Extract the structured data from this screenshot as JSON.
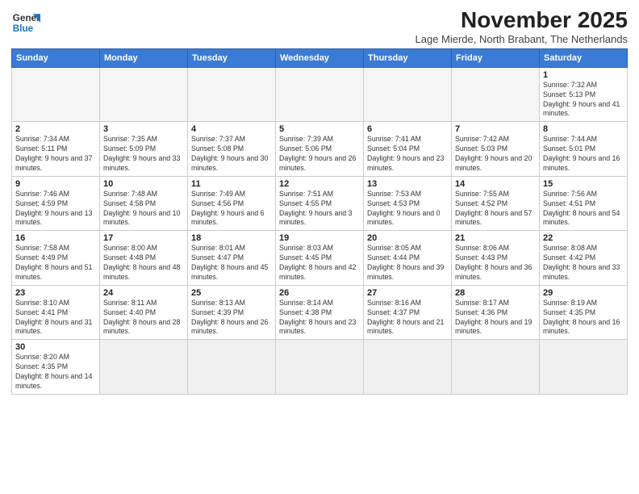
{
  "logo": {
    "line1": "General",
    "line2": "Blue"
  },
  "title": "November 2025",
  "subtitle": "Lage Mierde, North Brabant, The Netherlands",
  "headers": [
    "Sunday",
    "Monday",
    "Tuesday",
    "Wednesday",
    "Thursday",
    "Friday",
    "Saturday"
  ],
  "weeks": [
    [
      {
        "day": "",
        "info": ""
      },
      {
        "day": "",
        "info": ""
      },
      {
        "day": "",
        "info": ""
      },
      {
        "day": "",
        "info": ""
      },
      {
        "day": "",
        "info": ""
      },
      {
        "day": "",
        "info": ""
      },
      {
        "day": "1",
        "info": "Sunrise: 7:32 AM\nSunset: 5:13 PM\nDaylight: 9 hours and 41 minutes."
      }
    ],
    [
      {
        "day": "2",
        "info": "Sunrise: 7:34 AM\nSunset: 5:11 PM\nDaylight: 9 hours and 37 minutes."
      },
      {
        "day": "3",
        "info": "Sunrise: 7:35 AM\nSunset: 5:09 PM\nDaylight: 9 hours and 33 minutes."
      },
      {
        "day": "4",
        "info": "Sunrise: 7:37 AM\nSunset: 5:08 PM\nDaylight: 9 hours and 30 minutes."
      },
      {
        "day": "5",
        "info": "Sunrise: 7:39 AM\nSunset: 5:06 PM\nDaylight: 9 hours and 26 minutes."
      },
      {
        "day": "6",
        "info": "Sunrise: 7:41 AM\nSunset: 5:04 PM\nDaylight: 9 hours and 23 minutes."
      },
      {
        "day": "7",
        "info": "Sunrise: 7:42 AM\nSunset: 5:03 PM\nDaylight: 9 hours and 20 minutes."
      },
      {
        "day": "8",
        "info": "Sunrise: 7:44 AM\nSunset: 5:01 PM\nDaylight: 9 hours and 16 minutes."
      }
    ],
    [
      {
        "day": "9",
        "info": "Sunrise: 7:46 AM\nSunset: 4:59 PM\nDaylight: 9 hours and 13 minutes."
      },
      {
        "day": "10",
        "info": "Sunrise: 7:48 AM\nSunset: 4:58 PM\nDaylight: 9 hours and 10 minutes."
      },
      {
        "day": "11",
        "info": "Sunrise: 7:49 AM\nSunset: 4:56 PM\nDaylight: 9 hours and 6 minutes."
      },
      {
        "day": "12",
        "info": "Sunrise: 7:51 AM\nSunset: 4:55 PM\nDaylight: 9 hours and 3 minutes."
      },
      {
        "day": "13",
        "info": "Sunrise: 7:53 AM\nSunset: 4:53 PM\nDaylight: 9 hours and 0 minutes."
      },
      {
        "day": "14",
        "info": "Sunrise: 7:55 AM\nSunset: 4:52 PM\nDaylight: 8 hours and 57 minutes."
      },
      {
        "day": "15",
        "info": "Sunrise: 7:56 AM\nSunset: 4:51 PM\nDaylight: 8 hours and 54 minutes."
      }
    ],
    [
      {
        "day": "16",
        "info": "Sunrise: 7:58 AM\nSunset: 4:49 PM\nDaylight: 8 hours and 51 minutes."
      },
      {
        "day": "17",
        "info": "Sunrise: 8:00 AM\nSunset: 4:48 PM\nDaylight: 8 hours and 48 minutes."
      },
      {
        "day": "18",
        "info": "Sunrise: 8:01 AM\nSunset: 4:47 PM\nDaylight: 8 hours and 45 minutes."
      },
      {
        "day": "19",
        "info": "Sunrise: 8:03 AM\nSunset: 4:45 PM\nDaylight: 8 hours and 42 minutes."
      },
      {
        "day": "20",
        "info": "Sunrise: 8:05 AM\nSunset: 4:44 PM\nDaylight: 8 hours and 39 minutes."
      },
      {
        "day": "21",
        "info": "Sunrise: 8:06 AM\nSunset: 4:43 PM\nDaylight: 8 hours and 36 minutes."
      },
      {
        "day": "22",
        "info": "Sunrise: 8:08 AM\nSunset: 4:42 PM\nDaylight: 8 hours and 33 minutes."
      }
    ],
    [
      {
        "day": "23",
        "info": "Sunrise: 8:10 AM\nSunset: 4:41 PM\nDaylight: 8 hours and 31 minutes."
      },
      {
        "day": "24",
        "info": "Sunrise: 8:11 AM\nSunset: 4:40 PM\nDaylight: 8 hours and 28 minutes."
      },
      {
        "day": "25",
        "info": "Sunrise: 8:13 AM\nSunset: 4:39 PM\nDaylight: 8 hours and 26 minutes."
      },
      {
        "day": "26",
        "info": "Sunrise: 8:14 AM\nSunset: 4:38 PM\nDaylight: 8 hours and 23 minutes."
      },
      {
        "day": "27",
        "info": "Sunrise: 8:16 AM\nSunset: 4:37 PM\nDaylight: 8 hours and 21 minutes."
      },
      {
        "day": "28",
        "info": "Sunrise: 8:17 AM\nSunset: 4:36 PM\nDaylight: 8 hours and 19 minutes."
      },
      {
        "day": "29",
        "info": "Sunrise: 8:19 AM\nSunset: 4:35 PM\nDaylight: 8 hours and 16 minutes."
      }
    ],
    [
      {
        "day": "30",
        "info": "Sunrise: 8:20 AM\nSunset: 4:35 PM\nDaylight: 8 hours and 14 minutes."
      },
      {
        "day": "",
        "info": ""
      },
      {
        "day": "",
        "info": ""
      },
      {
        "day": "",
        "info": ""
      },
      {
        "day": "",
        "info": ""
      },
      {
        "day": "",
        "info": ""
      },
      {
        "day": "",
        "info": ""
      }
    ]
  ]
}
